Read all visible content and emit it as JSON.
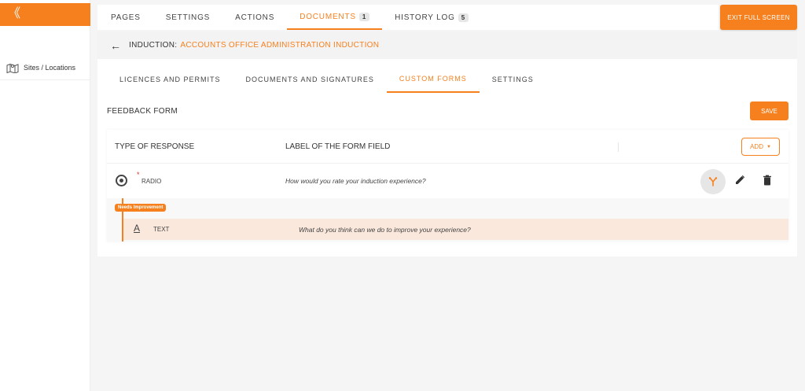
{
  "sidebar": {
    "collapse_glyph": "《",
    "items": [
      {
        "label": "Sites / Locations",
        "icon": "map-icon"
      }
    ]
  },
  "topnav": {
    "tabs": [
      {
        "label": "PAGES"
      },
      {
        "label": "SETTINGS"
      },
      {
        "label": "ACTIONS"
      },
      {
        "label": "DOCUMENTS",
        "badge": "1",
        "active": true
      },
      {
        "label": "HISTORY LOG",
        "badge": "5"
      }
    ],
    "exit_label": "EXIT FULL SCREEN"
  },
  "header": {
    "label": "INDUCTION:",
    "value": "ACCOUNTS OFFICE ADMINISTRATION INDUCTION"
  },
  "subtabs": [
    {
      "label": "LICENCES AND PERMITS"
    },
    {
      "label": "DOCUMENTS AND SIGNATURES"
    },
    {
      "label": "CUSTOM FORMS",
      "active": true
    },
    {
      "label": "SETTINGS"
    }
  ],
  "form": {
    "title": "FEEDBACK FORM",
    "save_label": "SAVE",
    "columns": {
      "type": "TYPE OF RESPONSE",
      "label": "LABEL OF THE FORM FIELD"
    },
    "add_label": "ADD",
    "rows": [
      {
        "required_mark": "*",
        "type": "RADIO",
        "label": "How would you rate your induction experience?"
      }
    ],
    "condition_badge": "Needs Improvement",
    "sub_rows": [
      {
        "icon_glyph": "A",
        "type": "TEXT",
        "label": "What do you think can we do to improve your experience?"
      }
    ]
  },
  "colors": {
    "accent": "#f7801e",
    "highlight_row": "#fbe8dc"
  }
}
